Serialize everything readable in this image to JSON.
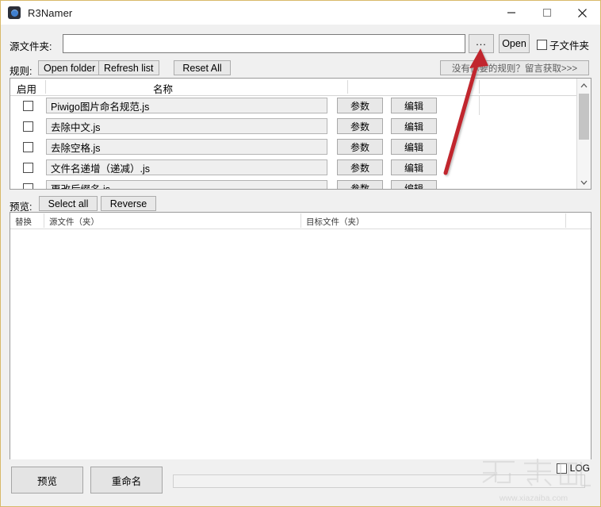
{
  "window": {
    "title": "R3Namer",
    "icon": "app-icon",
    "controls": {
      "minimize": "minimize-icon",
      "maximize": "maximize-icon",
      "close": "close-icon"
    }
  },
  "source_row": {
    "label": "源文件夹:",
    "input_value": "",
    "input_placeholder": "",
    "browse_label": "...",
    "open_label": "Open",
    "subfolder_label": "子文件夹",
    "subfolder_checked": false
  },
  "rules_toolbar": {
    "label": "规则:",
    "open_folder_label": "Open folder",
    "refresh_list_label": "Refresh list",
    "reset_all_label": "Reset All",
    "promo_label": "没有你要的规则？留言获取>>>"
  },
  "rules_table": {
    "headers": {
      "enable": "启用",
      "name": "名称"
    },
    "param_label": "参数",
    "edit_label": "编辑",
    "rows": [
      {
        "enabled": false,
        "name": "Piwigo图片命名规范.js"
      },
      {
        "enabled": false,
        "name": "去除中文.js"
      },
      {
        "enabled": false,
        "name": "去除空格.js"
      },
      {
        "enabled": false,
        "name": "文件名递增（递减）.js"
      },
      {
        "enabled": false,
        "name": "更改后缀名.js"
      }
    ],
    "scroll_up_icon": "chevron-up-icon",
    "scroll_down_icon": "chevron-down-icon"
  },
  "preview_toolbar": {
    "label": "预览:",
    "select_all_label": "Select all",
    "reverse_label": "Reverse"
  },
  "preview_table": {
    "headers": [
      "替换",
      "源文件（夹）",
      "目标文件（夹）"
    ],
    "rows": []
  },
  "bottom_bar": {
    "preview_label": "预览",
    "rename_label": "重命名",
    "log_label": "LOG",
    "log_checked": false,
    "progress_value": 0
  },
  "watermark": {
    "text": "下载吧",
    "url": "www.xiazaiba.com"
  },
  "annotation": {
    "type": "red-arrow",
    "points_to": "browse-button",
    "color": "#c1272d"
  }
}
